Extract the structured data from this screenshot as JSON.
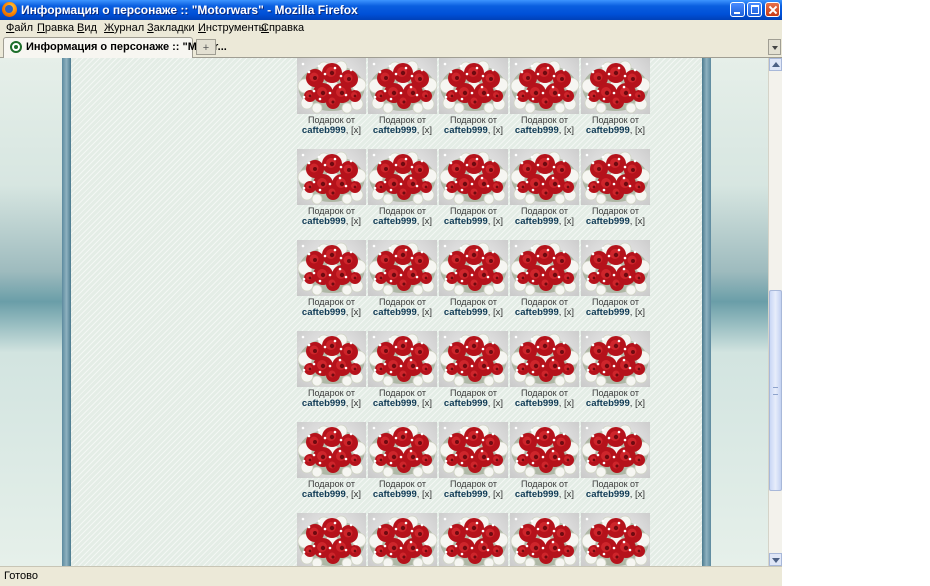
{
  "window": {
    "title": "Информация о персонаже :: \"Motorwars\" - Mozilla Firefox"
  },
  "menu": {
    "items": [
      "Файл",
      "Правка",
      "Вид",
      "Журнал",
      "Закладки",
      "Инструменты",
      "Справка"
    ]
  },
  "tabs": {
    "active_label": "Информация о персонаже :: \"Motor...",
    "new_tab_glyph": "+"
  },
  "gifts": {
    "columns": 5,
    "rows": 6,
    "caption_prefix": "Подарок от",
    "sender": "cafteb999",
    "separator": ",",
    "remove_label": "[x]",
    "image": "red-white-rose-bouquet"
  },
  "status": {
    "text": "Готово"
  },
  "colors": {
    "titlebar": "#0a5fe0",
    "sender_text": "#0f3a55",
    "rose": "#b5121b"
  }
}
